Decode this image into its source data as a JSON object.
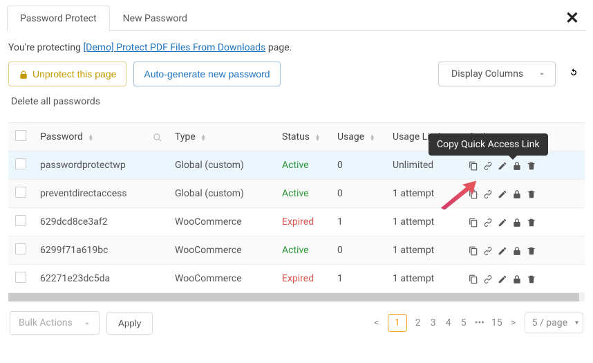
{
  "tabs": {
    "t1": "Password Protect",
    "t2": "New Password"
  },
  "intro": {
    "prefix": "You're protecting ",
    "link": "[Demo] Protect PDF Files From Downloads",
    "suffix": " page."
  },
  "toolbar": {
    "unprotect": "Unprotect this page",
    "autogen": "Auto-generate new password",
    "delete_all": "Delete all passwords",
    "display_cols": "Display Columns"
  },
  "tooltip": "Copy Quick Access Link",
  "columns": {
    "password": "Password",
    "type": "Type",
    "status": "Status",
    "usage": "Usage",
    "usage_limit": "Usage Limit",
    "action": "Action"
  },
  "rows": [
    {
      "pw": "passwordprotectwp",
      "type": "Global (custom)",
      "status": "Active",
      "usage": "0",
      "limit": "Unlimited"
    },
    {
      "pw": "preventdirectaccess",
      "type": "Global (custom)",
      "status": "Active",
      "usage": "0",
      "limit": "1 attempt"
    },
    {
      "pw": "629dcd8ce3af2",
      "type": "WooCommerce",
      "status": "Expired",
      "usage": "1",
      "limit": "1 attempt"
    },
    {
      "pw": "6299f71a619bc",
      "type": "WooCommerce",
      "status": "Active",
      "usage": "0",
      "limit": "1 attempt"
    },
    {
      "pw": "62271e23dc5da",
      "type": "WooCommerce",
      "status": "Expired",
      "usage": "1",
      "limit": "1 attempt"
    }
  ],
  "footer": {
    "bulk": "Bulk Actions",
    "apply": "Apply",
    "pages": [
      "1",
      "2",
      "3",
      "4",
      "5"
    ],
    "ellipsis": "•••",
    "last": "15",
    "size": "5 / page"
  }
}
